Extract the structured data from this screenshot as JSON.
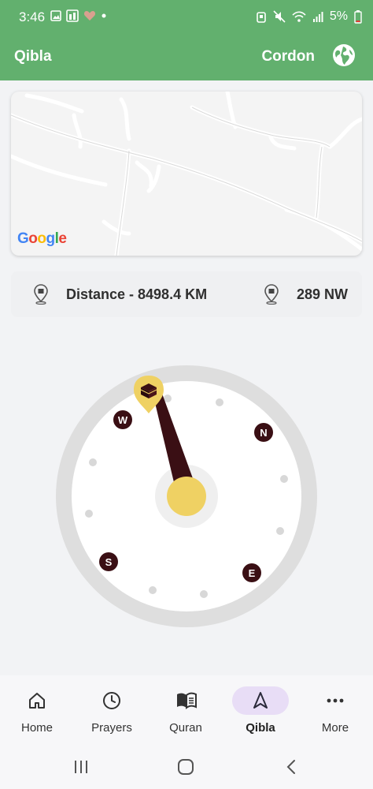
{
  "status_bar": {
    "time": "3:46",
    "battery": "5%",
    "left_icons": [
      "image-icon",
      "gallery-icon",
      "heart-icon",
      "dot-icon"
    ],
    "right_icons": [
      "alarm-icon",
      "mute-icon",
      "wifi-icon",
      "signal-icon",
      "battery-icon"
    ]
  },
  "app_bar": {
    "title": "Qibla",
    "location": "Cordon",
    "action_icon": "globe-icon"
  },
  "map": {
    "logo_letters": [
      "G",
      "o",
      "o",
      "g",
      "l",
      "e"
    ],
    "logo_colors": [
      "#4285F4",
      "#EA4335",
      "#FBBC05",
      "#4285F4",
      "#34A853",
      "#EA4335"
    ]
  },
  "info": {
    "distance": "Distance - 8498.4 KM",
    "direction": "289 NW"
  },
  "compass": {
    "qibla_bearing_deg": 289,
    "cardinals": [
      "N",
      "E",
      "S",
      "W"
    ],
    "marker_icon": "kaaba-icon",
    "needle_color": "#3a0f14",
    "accent_color": "#efd163"
  },
  "bottom_nav": {
    "items": [
      {
        "label": "Home",
        "icon": "home-icon"
      },
      {
        "label": "Prayers",
        "icon": "clock-icon"
      },
      {
        "label": "Quran",
        "icon": "book-icon"
      },
      {
        "label": "Qibla",
        "icon": "navigation-arrow-icon"
      },
      {
        "label": "More",
        "icon": "more-dots-icon"
      }
    ],
    "active": "Qibla"
  },
  "system_nav": [
    "recents-icon",
    "home-circle-icon",
    "back-icon"
  ]
}
